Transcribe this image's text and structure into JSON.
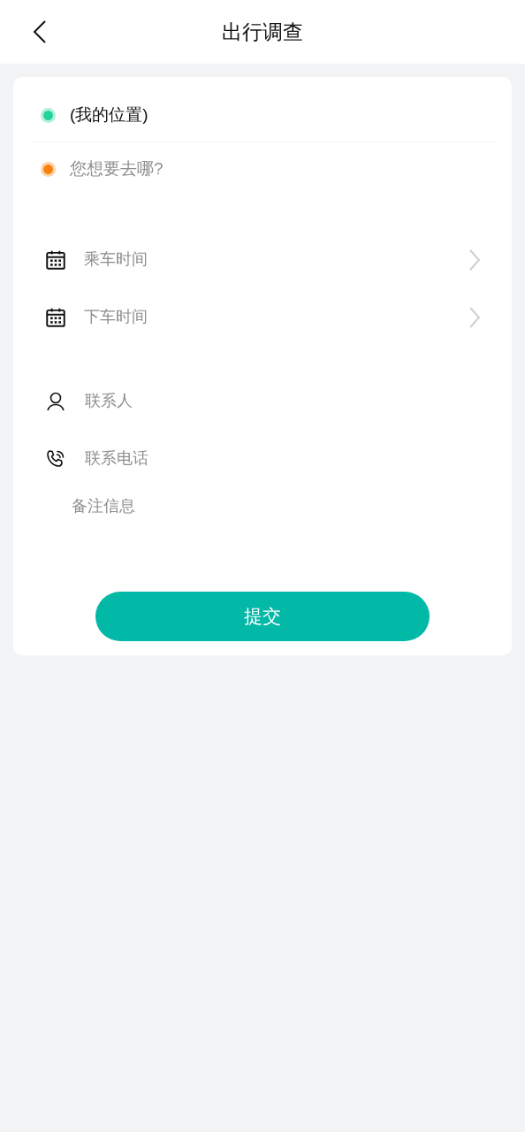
{
  "header": {
    "title": "出行调查"
  },
  "locations": [
    {
      "kind": "origin",
      "value": "(我的位置)",
      "color": "#22d39b"
    },
    {
      "kind": "destination",
      "placeholder": "您想要去哪?",
      "color": "#f7820f"
    }
  ],
  "time_fields": [
    {
      "placeholder": "乘车时间"
    },
    {
      "placeholder": "下车时间"
    }
  ],
  "contact_fields": [
    {
      "kind": "name",
      "placeholder": "联系人"
    },
    {
      "kind": "phone",
      "placeholder": "联系电话"
    }
  ],
  "remarks": {
    "placeholder": "备注信息"
  },
  "submit_button": "提交"
}
